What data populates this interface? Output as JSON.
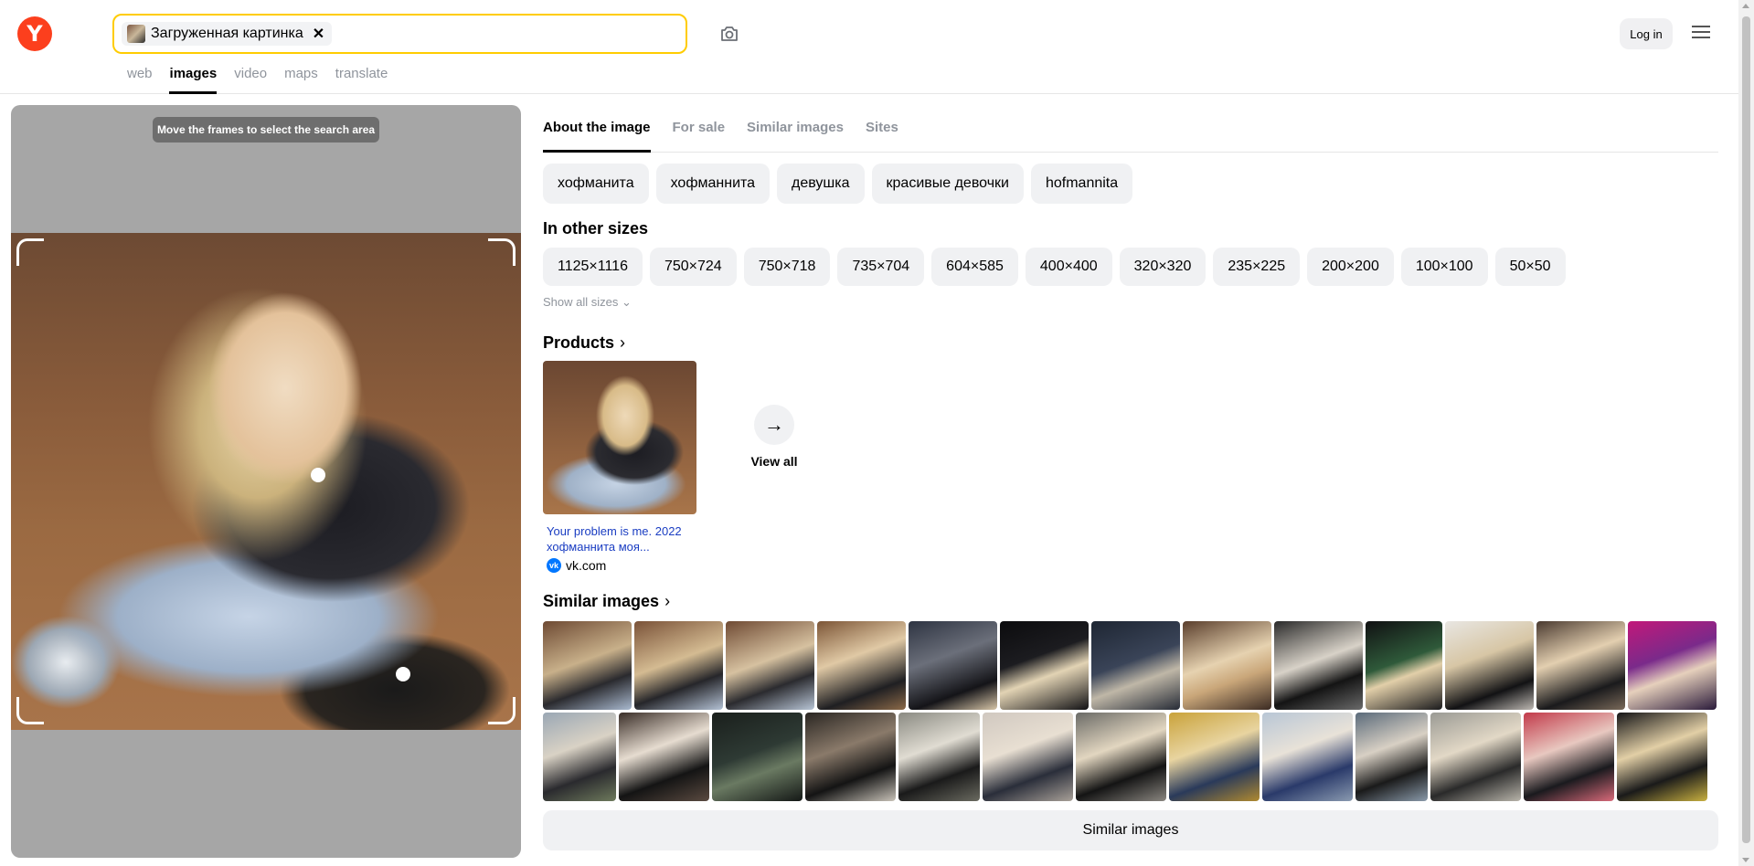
{
  "header": {
    "logo_letter": "Y",
    "search_chip_label": "Загруженная картинка",
    "search_chip_close": "✕",
    "login_label": "Log in"
  },
  "nav": [
    {
      "label": "web",
      "active": false
    },
    {
      "label": "images",
      "active": true
    },
    {
      "label": "video",
      "active": false
    },
    {
      "label": "maps",
      "active": false
    },
    {
      "label": "translate",
      "active": false
    }
  ],
  "left_panel": {
    "tooltip": "Move the frames to select the search area"
  },
  "tabs": [
    {
      "label": "About the image",
      "active": true
    },
    {
      "label": "For sale",
      "active": false
    },
    {
      "label": "Similar images",
      "active": false
    },
    {
      "label": "Sites",
      "active": false
    }
  ],
  "tags": [
    "хофманита",
    "хофманнита",
    "девушка",
    "красивые девочки",
    "hofmannita"
  ],
  "other_sizes": {
    "heading": "In other sizes",
    "items": [
      "1125×1116",
      "750×724",
      "750×718",
      "735×704",
      "604×585",
      "400×400",
      "320×320",
      "235×225",
      "200×200",
      "100×100",
      "50×50"
    ],
    "show_all": "Show all sizes"
  },
  "products": {
    "heading": "Products",
    "items": [
      {
        "title": "Your problem is me. 2022 хофманнита моя...",
        "source": "vk.com"
      }
    ],
    "view_all": "View all"
  },
  "similar": {
    "heading": "Similar images",
    "button": "Similar images"
  },
  "colors": {
    "accent_yellow": "#ffcc00",
    "logo_red": "#fc3f1d",
    "link_blue": "#1a3dc2",
    "muted": "#8f949c",
    "chip_bg": "#f0f1f3"
  }
}
